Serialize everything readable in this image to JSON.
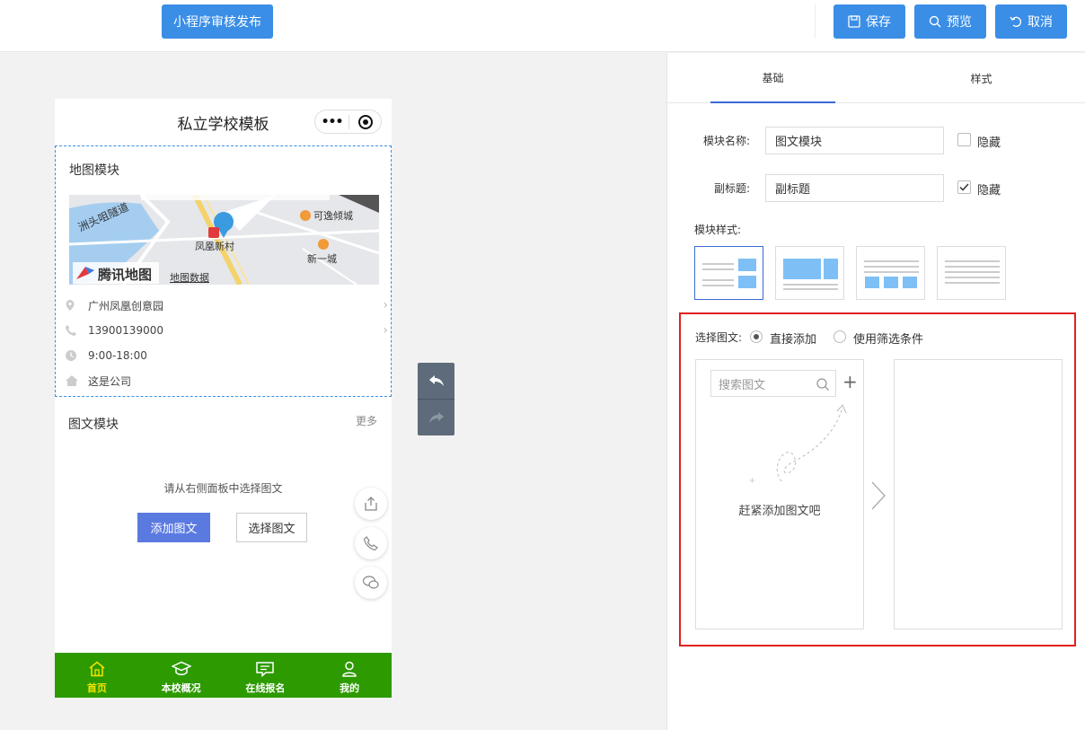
{
  "topbar": {
    "publish_label": "小程序审核发布",
    "save_label": "保存",
    "preview_label": "预览",
    "cancel_label": "取消",
    "accent_color": "#3a8ee6"
  },
  "phone": {
    "title": "私立学校模板",
    "map_module": {
      "title": "地图模块",
      "map": {
        "labels": [
          "洲头咀隧道",
          "可逸倾城",
          "凤凰新村",
          "新一城"
        ],
        "brand": "腾讯地图",
        "data_link": "地图数据"
      },
      "address": "广州凤凰创意园",
      "phone": "13900139000",
      "hours": "9:00-18:00",
      "company": "这是公司"
    },
    "tuwen_module": {
      "title": "图文模块",
      "more": "更多",
      "hint": "请从右侧面板中选择图文",
      "add_label": "添加图文",
      "select_label": "选择图文"
    },
    "tabbar": {
      "color": "#2d9a00",
      "active_color": "#f2e400",
      "items": [
        {
          "label": "首页",
          "icon": "home-icon",
          "active": true
        },
        {
          "label": "本校概况",
          "icon": "graduation-cap-icon",
          "active": false
        },
        {
          "label": "在线报名",
          "icon": "message-icon",
          "active": false
        },
        {
          "label": "我的",
          "icon": "user-icon",
          "active": false
        }
      ]
    }
  },
  "panel": {
    "tabs": [
      "基础",
      "样式"
    ],
    "module_name_label": "模块名称:",
    "module_name_value": "图文模块",
    "hide_label": "隐藏",
    "hide_name_checked": false,
    "subtitle_label": "副标题:",
    "subtitle_value": "副标题",
    "hide_subtitle_checked": true,
    "module_style_label": "模块样式:",
    "select_label": "选择图文:",
    "option_direct": "直接添加",
    "option_filter": "使用筛选条件",
    "search_placeholder": "搜索图文",
    "empty_text": "赶紧添加图文吧"
  }
}
